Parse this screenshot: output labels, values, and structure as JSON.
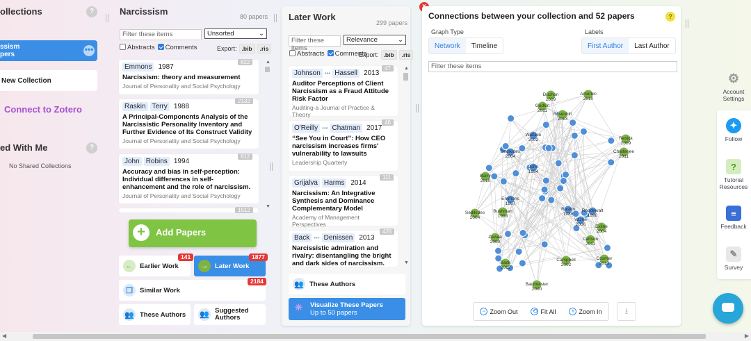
{
  "collections_panel": {
    "title": "ollections",
    "help": "?",
    "active_collection": {
      "line1": "ssism",
      "line2": "pers",
      "menu": "•••"
    },
    "new_collection": "New Collection",
    "connect_zotero": "Connect to Zotero",
    "shared_title": "ed With Me",
    "shared_help": "?",
    "no_shared": "No Shared Collections"
  },
  "collection": {
    "title": "Narcissism",
    "count": "80 papers",
    "filter_placeholder": "Filter these items",
    "sort": "Unsorted",
    "abstracts_label": "Abstracts",
    "comments_label": "Comments",
    "export_label": "Export:",
    "bib": ".bib",
    "ris": ".ris",
    "papers": [
      {
        "authors": [
          "Emmons"
        ],
        "more": false,
        "year": "1987",
        "title": "Narcissism: theory and measurement",
        "venue": "Journal of Personality and Social Psychology",
        "citations": "822"
      },
      {
        "authors": [
          "Raskin",
          "Terry"
        ],
        "more": false,
        "year": "1988",
        "title": "A Principal-Components Analysis of the Narcissistic Personality Inventory and Further Evidence of Its Construct Validity",
        "venue": "Journal of Personality and Social Psychology",
        "citations": "2132"
      },
      {
        "authors": [
          "John",
          "Robins"
        ],
        "more": false,
        "year": "1994",
        "title": "Accuracy and bias in self-perception: Individual differences in self-enhancement and the role of narcissism.",
        "venue": "Journal of Personality and Social Psychology",
        "citations": "812"
      },
      {
        "partial_citations": "1512"
      }
    ],
    "add_papers": "Add Papers",
    "nav": {
      "earlier": {
        "label": "Earlier Work",
        "count": "141"
      },
      "later": {
        "label": "Later Work",
        "count": "1877"
      },
      "similar": {
        "label": "Similar Work",
        "count": "2184"
      },
      "authors": {
        "label": "These Authors"
      },
      "suggested": {
        "label": "Suggested Authors"
      }
    }
  },
  "later_work": {
    "title": "Later Work",
    "count": "299 papers",
    "filter_placeholder": "Filter these items",
    "sort": "Relevance",
    "abstracts_label": "Abstracts",
    "comments_label": "Comments",
    "export_label": "Export:",
    "bib": ".bib",
    "ris": ".ris",
    "papers": [
      {
        "a1": "Johnson",
        "a2": "Hassell",
        "more": true,
        "year": "2013",
        "title": "Auditor Perceptions of Client Narcissism as a Fraud Attitude Risk Factor",
        "venue": "Auditing-a Journal of Practice & Theory",
        "citations": "47"
      },
      {
        "a1": "O'Reilly",
        "a2": "Chatman",
        "more": true,
        "year": "2017",
        "title": "“See You in Court”: How CEO narcissism increases firms' vulnerability to lawsuits",
        "venue": "Leadership Quarterly",
        "citations": "46"
      },
      {
        "a1": "Grijalva",
        "a2": "Harms",
        "more": false,
        "year": "2014",
        "title": "Narcissism: An Integrative Synthesis and Dominance Complementary Model",
        "venue": "Academy of Management Perspectives",
        "citations": "111"
      },
      {
        "a1": "Back",
        "a2": "Denissen",
        "more": true,
        "year": "2013",
        "title": "Narcissistic admiration and rivalry: disentangling the bright and dark sides of narcissism.",
        "venue": "",
        "citations": "426"
      }
    ],
    "these_authors": "These Authors",
    "visualize": "Visualize These Papers",
    "visualize_sub": "Up to 50 papers"
  },
  "graph": {
    "close": "×",
    "title": "Connections between your collection and 52 papers",
    "help": "?",
    "graph_type_label": "Graph Type",
    "network": "Network",
    "timeline": "Timeline",
    "labels_label": "Labels",
    "first_author": "First Author",
    "last_author": "Last Author",
    "filter_placeholder": "Filter these items",
    "zoom_out": "Zoom Out",
    "fit_all": "Fit All",
    "zoom_in": "Zoom In",
    "colors": {
      "green": "#7cb342",
      "blue": "#4f8fd8"
    },
    "labeled_nodes": [
      {
        "name": "Duchon",
        "year": "2009",
        "kind": "green"
      },
      {
        "name": "Amernic",
        "year": "2010",
        "kind": "green"
      },
      {
        "name": "Godkin",
        "year": "2011",
        "kind": "green"
      },
      {
        "name": "Rijsenbilt",
        "year": "2013",
        "kind": "green"
      },
      {
        "name": "Wallace",
        "year": "2002",
        "kind": "blue"
      },
      {
        "name": "Resick",
        "year": "2009",
        "kind": "green"
      },
      {
        "name": "Chatterjee",
        "year": "2011",
        "kind": "green"
      },
      {
        "name": "Sedikides",
        "year": "2004",
        "kind": "blue"
      },
      {
        "name": "Emmons",
        "year": "1987",
        "kind": "blue"
      },
      {
        "name": "John",
        "year": "1994",
        "kind": "blue"
      },
      {
        "name": "Barry",
        "year": "2010",
        "kind": "green"
      },
      {
        "name": "Bushman",
        "year": "1998",
        "kind": "green"
      },
      {
        "name": "Raskin",
        "year": "1988",
        "kind": "blue"
      },
      {
        "name": "Rhodewalt",
        "year": "1998",
        "kind": "blue"
      },
      {
        "name": "Vazire",
        "year": "2006",
        "kind": "blue"
      },
      {
        "name": "Exline",
        "year": "2004",
        "kind": "green"
      },
      {
        "name": "Sedikides",
        "year": "2004",
        "kind": "green"
      },
      {
        "name": "Zavala",
        "year": "2009",
        "kind": "green"
      },
      {
        "name": "Carlson",
        "year": "2011",
        "kind": "green"
      },
      {
        "name": "Campbell",
        "year": "2002",
        "kind": "green"
      },
      {
        "name": "Back",
        "year": "2013",
        "kind": "green"
      },
      {
        "name": "Cosmer",
        "year": "2013",
        "kind": "green"
      },
      {
        "name": "Baumeister",
        "year": "2000",
        "kind": "green"
      }
    ]
  },
  "rail": {
    "account": "Account Settings",
    "follow": "Follow",
    "tutorial": "Tutorial Resources",
    "feedback": "Feedback",
    "survey": "Survey"
  }
}
